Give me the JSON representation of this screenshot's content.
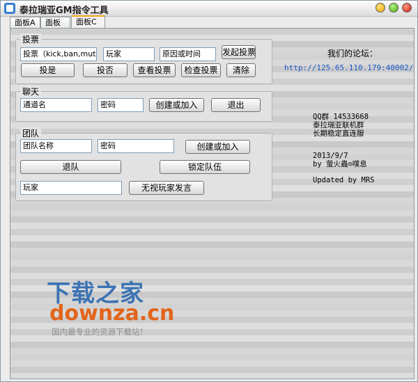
{
  "window": {
    "title": "泰拉瑞亚GM指令工具"
  },
  "tabs": [
    {
      "label": "面板A"
    },
    {
      "label": "面板B"
    },
    {
      "label": "面板C"
    }
  ],
  "vote": {
    "legend": "投票",
    "type_field": "投票（kick,ban,mute,",
    "player_field": "玩家",
    "reason_field": "原因或时间",
    "start_button": "发起投票",
    "yes_button": "投是",
    "no_button": "投否",
    "view_button": "查看投票",
    "check_button": "检查投票",
    "clear_button": "清除"
  },
  "chat": {
    "legend": "聊天",
    "channel_field": "通道名",
    "password_field": "密码",
    "create_button": "创建或加入",
    "exit_button": "退出"
  },
  "team": {
    "legend": "团队",
    "name_field": "团队名称",
    "password_field": "密码",
    "create_button": "创建或加入",
    "leave_button": "退队",
    "lock_button": "锁定队伍",
    "player_field": "玩家",
    "ignore_button": "无视玩家发言"
  },
  "info": {
    "forum_label": "我们的论坛：",
    "forum_url": "http://125.65.110.179:40002/",
    "qq_line": "QQ群 14533668",
    "group_line1": "泰拉瑞亚联机群",
    "group_line2": "长期稳定直连服",
    "date": "2013/9/7",
    "author": "by 萤火蟲⊙噗息",
    "updated": "Updated by MRS"
  },
  "watermark": {
    "cn": "下载之家",
    "en": "downza.cn",
    "slogan": "国内最专业的资源下载站！"
  },
  "colors": {
    "tab_active_accent": "#f7a21b",
    "link": "#1a57c8",
    "watermark_blue": "#3c73b4",
    "watermark_orange": "#e2651a"
  }
}
